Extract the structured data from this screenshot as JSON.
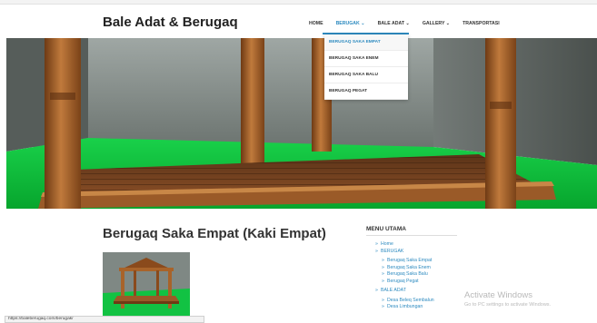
{
  "site": {
    "title": "Bale Adat & Berugaq"
  },
  "nav": {
    "items": [
      {
        "label": "HOME"
      },
      {
        "label": "BERUGAK",
        "active": true
      },
      {
        "label": "BALE ADAT"
      },
      {
        "label": "GALLERY"
      },
      {
        "label": "TRANSPORTASI"
      }
    ],
    "chevron": "⌄",
    "dropdown": [
      {
        "label": "BERUGAQ SAKA EMPAT"
      },
      {
        "label": "BERUGAQ SAKA ENEM"
      },
      {
        "label": "BERUGAQ SAKA BALU"
      },
      {
        "label": "BERUGAQ PEGAT"
      }
    ]
  },
  "content": {
    "title": "Berugaq Saka Empat (Kaki Empat)"
  },
  "sidebar": {
    "title": "MENU UTAMA",
    "items": [
      {
        "label": "Home"
      },
      {
        "label": "BERUGAK"
      },
      {
        "label": "Berugaq Saka Empat"
      },
      {
        "label": "Berugaq Saka Enem"
      },
      {
        "label": "Berugaq Saka Balu"
      },
      {
        "label": "Berugaq Pegat"
      },
      {
        "label": "BALE ADAT"
      },
      {
        "label": "Desa Beleq Sembalun"
      },
      {
        "label": "Desa Limbungan"
      }
    ]
  },
  "watermark": {
    "title": "Activate Windows",
    "subtitle": "Go to PC settings to activate Windows."
  },
  "status": {
    "url": "https://baleberugaq.com/berugak/"
  },
  "colors": {
    "accent": "#2e8bc0",
    "floor_green": "#0fbf3c",
    "wood": "#a8632a"
  },
  "icons": {
    "chevron": "chevron-down-icon",
    "bullet": "double-angle-right-icon"
  }
}
